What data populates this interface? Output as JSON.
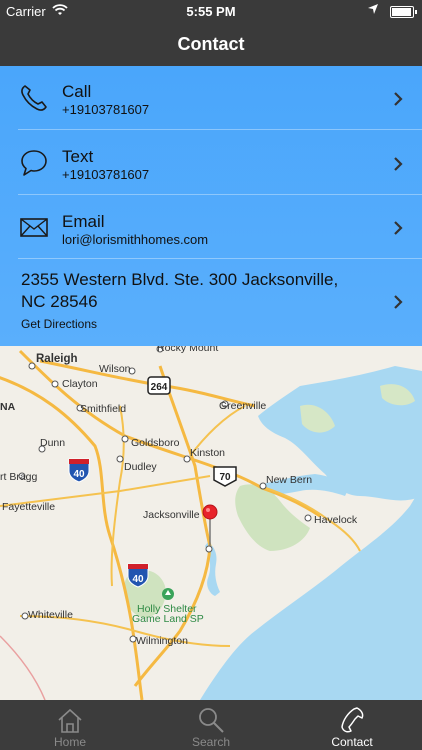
{
  "status_bar": {
    "carrier": "Carrier",
    "time": "5:55 PM"
  },
  "nav": {
    "title": "Contact"
  },
  "contact": {
    "call": {
      "label": "Call",
      "value": "+19103781607"
    },
    "text": {
      "label": "Text",
      "value": "+19103781607"
    },
    "email": {
      "label": "Email",
      "value": "lori@lorismithhomes.com"
    },
    "address": {
      "line": "2355 Western Blvd. Ste. 300 Jacksonville, NC 28546",
      "action": "Get Directions"
    }
  },
  "map": {
    "labels": {
      "rocky_mount": "Rocky Mount",
      "raleigh": "Raleigh",
      "wilson": "Wilson",
      "clayton": "Clayton",
      "hwy264": "264",
      "smithfield": "Smithfield",
      "greenville": "Greenville",
      "na": "NA",
      "dunn": "Dunn",
      "goldsboro": "Goldsboro",
      "kinston": "Kinston",
      "fort_bragg": "rt Bragg",
      "i40_top": "40",
      "dudley": "Dudley",
      "hwy70": "70",
      "new_bern": "New Bern",
      "fayetteville": "Fayetteville",
      "havelock": "Havelock",
      "jacksonville": "Jacksonville",
      "i40_bottom": "40",
      "holly_shelter_1": "Holly Shelter",
      "holly_shelter_2": "Game Land SP",
      "whiteville": "Whiteville",
      "wilmington": "Wilmington"
    }
  },
  "tabs": [
    {
      "label": "Home",
      "icon": "home-icon"
    },
    {
      "label": "Search",
      "icon": "search-icon"
    },
    {
      "label": "Contact",
      "icon": "phone-icon"
    }
  ],
  "colors": {
    "panel": "#4aa6fb",
    "bar": "#3a3a3a",
    "pin": "#e8232a"
  }
}
